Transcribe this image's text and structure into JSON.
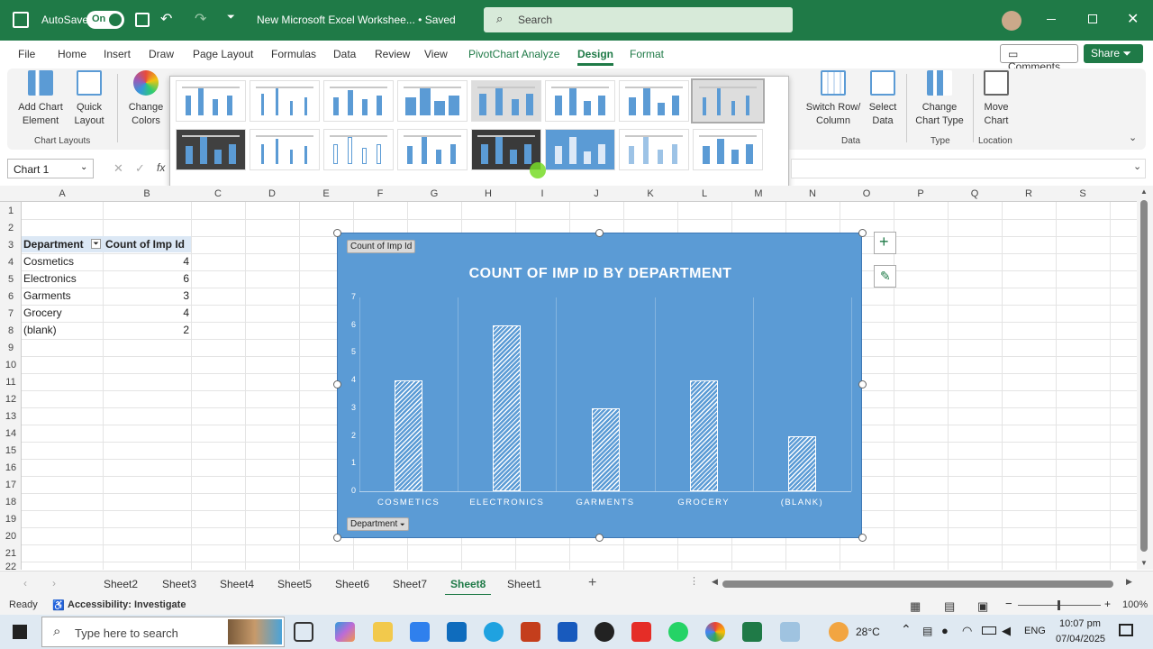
{
  "titlebar": {
    "autosave_label": "AutoSave",
    "autosave_state": "On",
    "doc_title": "New Microsoft Excel Workshee... • Saved",
    "search_placeholder": "Search"
  },
  "menu": {
    "tabs": [
      "File",
      "Home",
      "Insert",
      "Draw",
      "Page Layout",
      "Formulas",
      "Data",
      "Review",
      "View",
      "PivotChart Analyze",
      "Design",
      "Format"
    ],
    "comments": "Comments",
    "share": "Share"
  },
  "ribbon": {
    "add_chart_element": "Add Chart Element",
    "quick_layout": "Quick Layout",
    "change_colors": "Change Colors",
    "chart_layouts_group": "Chart Layouts",
    "switch_row_col": "Switch Row/ Column",
    "select_data": "Select Data",
    "data_group": "Data",
    "change_chart_type": "Change Chart Type",
    "type_group": "Type",
    "move_chart": "Move Chart",
    "location_group": "Location"
  },
  "formula_bar": {
    "name_box": "Chart 1",
    "fx": "fx"
  },
  "columns": [
    "A",
    "B",
    "C",
    "D",
    "E",
    "F",
    "G",
    "H",
    "I",
    "J",
    "K",
    "L",
    "M",
    "N",
    "O",
    "P",
    "Q",
    "R",
    "S"
  ],
  "rows": [
    "1",
    "2",
    "3",
    "4",
    "5",
    "6",
    "7",
    "8",
    "9",
    "10",
    "11",
    "12",
    "13",
    "14",
    "15",
    "16",
    "17",
    "18",
    "19",
    "20",
    "21",
    "22"
  ],
  "pivot": {
    "header_department": "Department",
    "header_count": "Count of Imp Id",
    "rows": [
      {
        "name": "Cosmetics",
        "count": "4"
      },
      {
        "name": "Electronics",
        "count": "6"
      },
      {
        "name": "Garments",
        "count": "3"
      },
      {
        "name": "Grocery",
        "count": "4"
      },
      {
        "name": "(blank)",
        "count": "2"
      }
    ]
  },
  "chart_data": {
    "type": "bar",
    "title": "COUNT OF IMP ID BY DEPARTMENT",
    "categories": [
      "COSMETICS",
      "ELECTRONICS",
      "GARMENTS",
      "GROCERY",
      "(BLANK)"
    ],
    "values": [
      4,
      6,
      3,
      4,
      2
    ],
    "ylim": [
      0,
      7
    ],
    "yticks": [
      "0",
      "1",
      "2",
      "3",
      "4",
      "5",
      "6",
      "7"
    ],
    "value_field_button": "Count of Imp Id",
    "axis_field_button": "Department",
    "grid": true,
    "bar_color": "#5b9bd5",
    "background_color": "#5b9bd5"
  },
  "sheets": {
    "tabs": [
      "Sheet2",
      "Sheet3",
      "Sheet4",
      "Sheet5",
      "Sheet6",
      "Sheet7",
      "Sheet8",
      "Sheet1"
    ],
    "active": "Sheet8"
  },
  "status": {
    "ready": "Ready",
    "accessibility": "Accessibility: Investigate",
    "zoom": "100%"
  },
  "taskbar": {
    "search_placeholder": "Type here to search",
    "weather": "28°C",
    "language": "ENG",
    "time": "10:07 pm",
    "date": "07/04/2025"
  }
}
